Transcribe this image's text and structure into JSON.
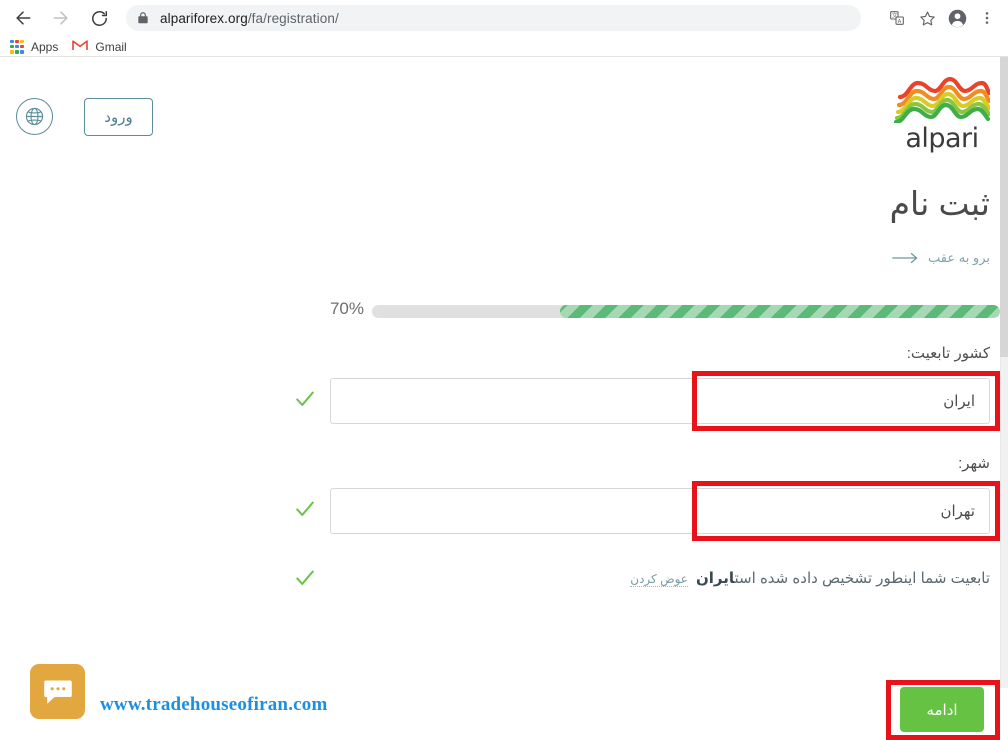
{
  "browser": {
    "url_prefix": "al",
    "url_highlight": "pariforex.org",
    "url_suffix": "/fa/registration/",
    "url_full": "alpariforex.org/fa/registration/",
    "back_icon": "back-arrow-icon",
    "forward_icon": "forward-arrow-icon",
    "reload_icon": "reload-icon",
    "lock_icon": "lock-icon",
    "translate_icon": "translate-icon",
    "bookmark_icon": "star-icon",
    "profile_icon": "account-avatar-icon",
    "menu_icon": "three-dot-menu-icon",
    "bookmarks": [
      {
        "label": "Apps",
        "icon": "apps-grid-icon"
      },
      {
        "label": "Gmail",
        "icon": "gmail-icon"
      }
    ]
  },
  "header": {
    "brand_name": "alpari",
    "brand_logo_icon": "alpari-waves-logo",
    "language_icon": "globe-icon",
    "login_label": "ورود"
  },
  "main": {
    "title": "ثبت نام",
    "back_link_label": "برو به عقب",
    "back_link_icon": "arrow-right-icon",
    "progress": {
      "percent_label": "70%",
      "percent_value": 70
    },
    "fields": [
      {
        "label": "کشور تابعیت:",
        "value": "ایران",
        "valid_icon": "green-checkmark-icon",
        "highlighted": true
      },
      {
        "label": "شهر:",
        "value": "تهران",
        "valid_icon": "green-checkmark-icon",
        "highlighted": true
      }
    ],
    "detection_hint": {
      "prefix": "تابعیت شما اینطور تشخیص داده شده است",
      "country": "ایران",
      "change_label": "عوض کردن",
      "valid_icon": "green-checkmark-icon"
    },
    "continue_label": "ادامه"
  },
  "watermark": {
    "site": "www.tradehouseofiran.com",
    "icon": "chat-bubble-icon"
  },
  "colors": {
    "accent_teal": "#5b8d9b",
    "progress_green": "#5cb978",
    "button_green": "#66c243",
    "annotation_red": "#e8131a",
    "watermark_blue": "#1d8fe0",
    "watermark_orange": "#e3a740"
  }
}
